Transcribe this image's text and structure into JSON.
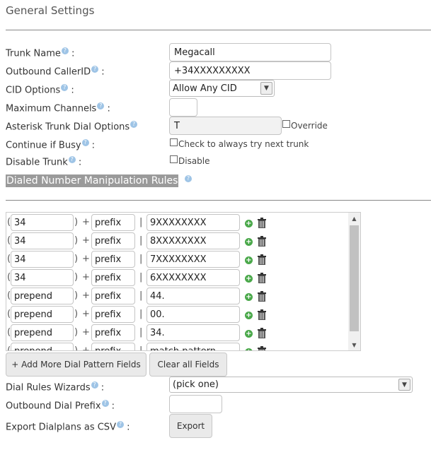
{
  "section_title": "General Settings",
  "help_glyph": "?",
  "fields": {
    "trunk_name": {
      "label": "Trunk Name",
      "value": "Megacall"
    },
    "outbound_callerid": {
      "label": "Outbound CallerID",
      "value": "+34XXXXXXXXX"
    },
    "cid_options": {
      "label": "CID Options",
      "value": "Allow Any CID"
    },
    "max_channels": {
      "label": "Maximum Channels",
      "value": ""
    },
    "dial_options": {
      "label": "Asterisk Trunk Dial Options",
      "value": "T",
      "override_label": "Override"
    },
    "continue_busy": {
      "label": "Continue if Busy",
      "checkbox_label": "Check to always try next trunk"
    },
    "disable_trunk": {
      "label": "Disable Trunk",
      "checkbox_label": "Disable"
    }
  },
  "dial_rules_title": "Dialed Number Manipulation Rules",
  "plus_glyph": "+",
  "pipe_glyph": "|",
  "open_paren": "(",
  "close_paren": ")",
  "pattern_rows": [
    {
      "prepend": "34",
      "prefix": "prefix",
      "pattern": "9XXXXXXXX"
    },
    {
      "prepend": "34",
      "prefix": "prefix",
      "pattern": "8XXXXXXXX"
    },
    {
      "prepend": "34",
      "prefix": "prefix",
      "pattern": "7XXXXXXXX"
    },
    {
      "prepend": "34",
      "prefix": "prefix",
      "pattern": "6XXXXXXXX"
    },
    {
      "prepend": "prepend",
      "prefix": "prefix",
      "pattern": "44."
    },
    {
      "prepend": "prepend",
      "prefix": "prefix",
      "pattern": "00."
    },
    {
      "prepend": "prepend",
      "prefix": "prefix",
      "pattern": "34."
    },
    {
      "prepend": "prepend",
      "prefix": "prefix",
      "pattern": "match pattern"
    }
  ],
  "buttons": {
    "add_more": "+ Add More Dial Pattern Fields",
    "clear_all": "Clear all Fields",
    "export": "Export"
  },
  "dial_rules_wizards": {
    "label": "Dial Rules Wizards",
    "value": "(pick one)"
  },
  "outbound_dial_prefix": {
    "label": "Outbound Dial Prefix",
    "value": ""
  },
  "export_csv": {
    "label": "Export Dialplans as CSV"
  }
}
